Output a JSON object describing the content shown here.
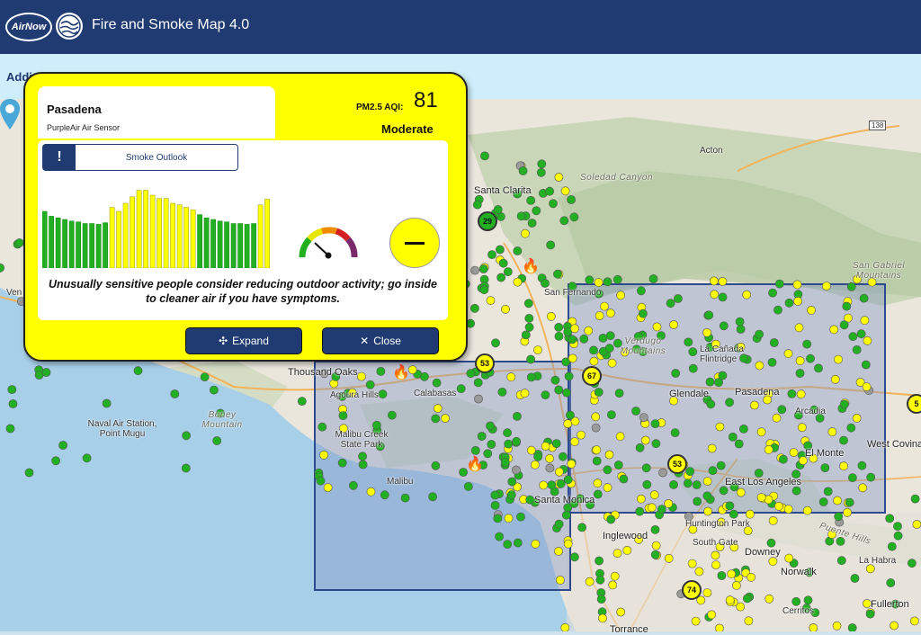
{
  "header": {
    "logo_text": "AirNow",
    "title": "Fire and Smoke Map 4.0"
  },
  "subbar": {
    "text": "Addi"
  },
  "popup": {
    "location": "Pasadena",
    "sensor_type": "PurpleAir Air Sensor",
    "aqi_label": "PM2.5 AQI:",
    "aqi_value": "81",
    "category": "Moderate",
    "smoke_outlook_label": "Smoke Outlook",
    "message": "Unusually sensitive people consider reducing outdoor activity; go inside to cleaner air if you have symptoms.",
    "expand_label": "Expand",
    "close_label": "Close",
    "history_colors": {
      "good": "#22b022",
      "moderate": "#ffff00"
    }
  },
  "map": {
    "labels": [
      {
        "text": "Acton",
        "cls": "big"
      },
      {
        "text": "Soledad Canyon",
        "cls": "terrain"
      },
      {
        "text": "Santa Clarita",
        "cls": "big"
      },
      {
        "text": "San Gabriel Mountains",
        "cls": "terrain"
      },
      {
        "text": "San Fernando",
        "cls": ""
      },
      {
        "text": "Verdugo Mountains",
        "cls": "terrain"
      },
      {
        "text": "La Cañada Flintridge",
        "cls": ""
      },
      {
        "text": "Thousand Oaks",
        "cls": "big"
      },
      {
        "text": "Agoura Hills",
        "cls": ""
      },
      {
        "text": "Calabasas",
        "cls": ""
      },
      {
        "text": "Glendale",
        "cls": "big"
      },
      {
        "text": "Pasadena",
        "cls": "big"
      },
      {
        "text": "Arcadia",
        "cls": ""
      },
      {
        "text": "Malibu Creek State Park",
        "cls": ""
      },
      {
        "text": "Boney Mountain",
        "cls": "terrain"
      },
      {
        "text": "Naval Air Station, Point Mugu",
        "cls": ""
      },
      {
        "text": "El Monte",
        "cls": "big"
      },
      {
        "text": "West Covina",
        "cls": "big"
      },
      {
        "text": "East Los Angeles",
        "cls": "big"
      },
      {
        "text": "Malibu",
        "cls": ""
      },
      {
        "text": "Santa Monica",
        "cls": "big"
      },
      {
        "text": "Huntington Park",
        "cls": ""
      },
      {
        "text": "Inglewood",
        "cls": "big"
      },
      {
        "text": "South Gate",
        "cls": ""
      },
      {
        "text": "Downey",
        "cls": "big"
      },
      {
        "text": "Norwalk",
        "cls": "big"
      },
      {
        "text": "La Habra",
        "cls": ""
      },
      {
        "text": "Puente Hills",
        "cls": "terrain"
      },
      {
        "text": "Cerritos",
        "cls": ""
      },
      {
        "text": "Fullerton",
        "cls": "big"
      },
      {
        "text": "Ven",
        "cls": ""
      },
      {
        "text": "Torrance",
        "cls": "big"
      },
      {
        "text": "138",
        "cls": ""
      }
    ],
    "clusters": [
      {
        "value": "29",
        "level": "good"
      },
      {
        "value": "53",
        "level": "moderate"
      },
      {
        "value": "67",
        "level": "moderate"
      },
      {
        "value": "53",
        "level": "moderate"
      },
      {
        "value": "74",
        "level": "moderate"
      },
      {
        "value": "5",
        "level": "moderate"
      }
    ],
    "aqi_colors": {
      "good": "#22b022",
      "moderate": "#ffff00",
      "unknown": "#9a9a9a"
    }
  }
}
